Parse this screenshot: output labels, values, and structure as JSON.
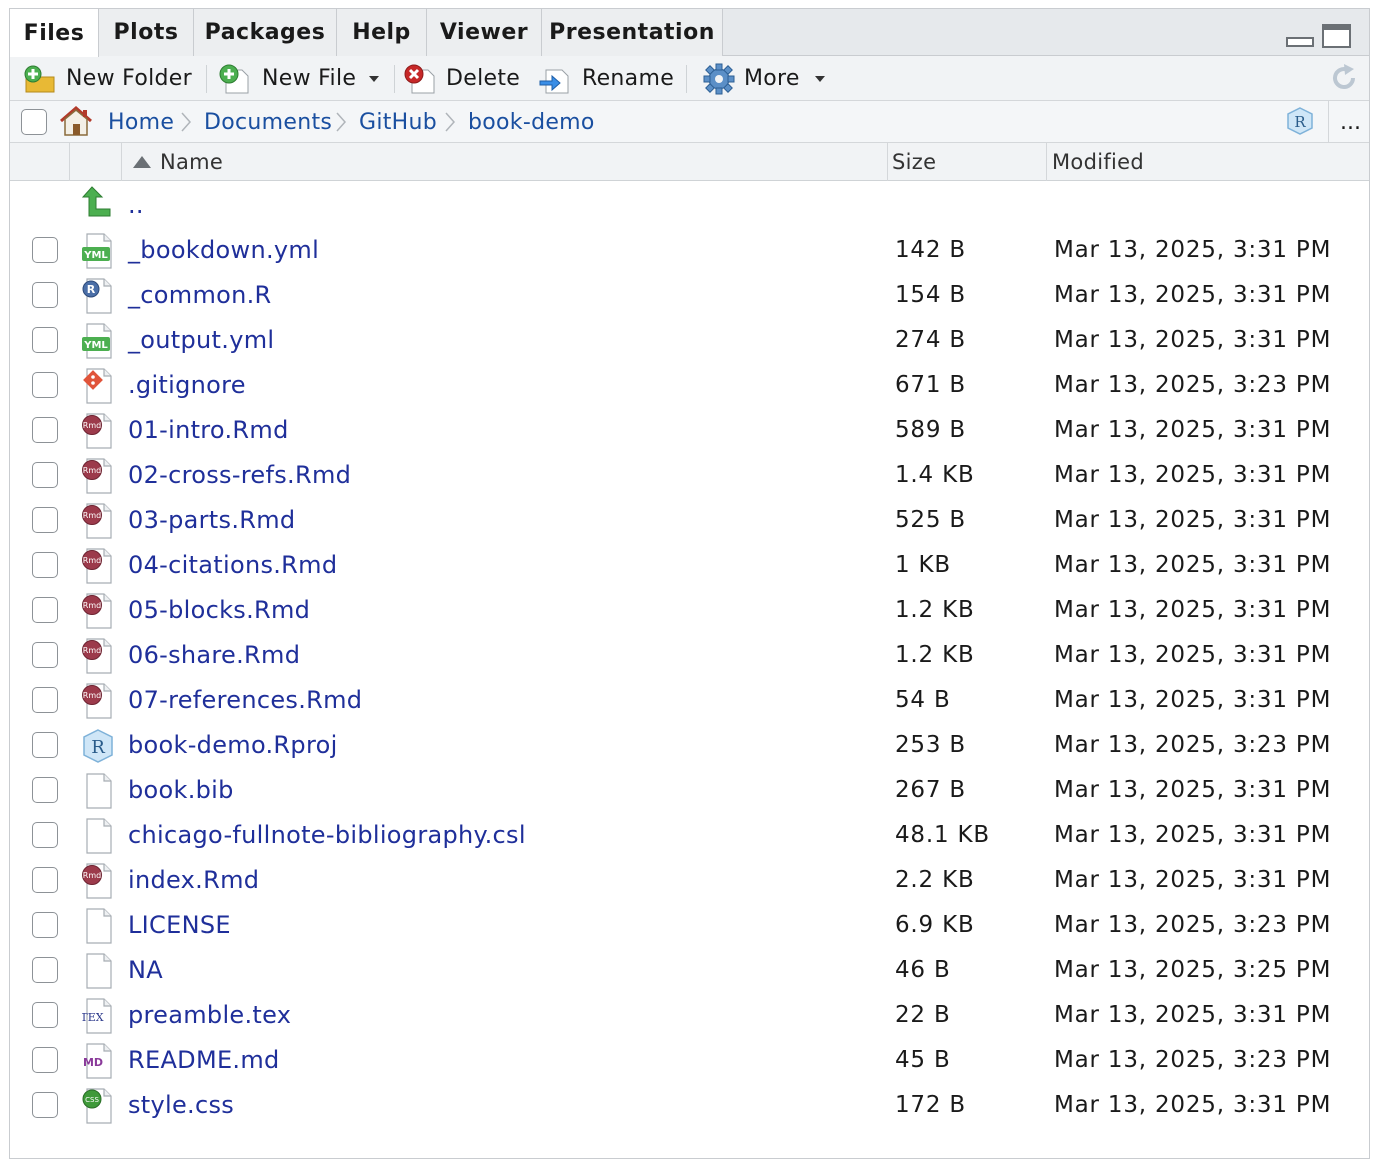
{
  "tabs": [
    "Files",
    "Plots",
    "Packages",
    "Help",
    "Viewer",
    "Presentation"
  ],
  "toolbar": {
    "new_folder": "New Folder",
    "new_file": "New File",
    "delete": "Delete",
    "rename": "Rename",
    "more": "More"
  },
  "breadcrumb": [
    "Home",
    "Documents",
    "GitHub",
    "book-demo"
  ],
  "more_label": "...",
  "columns": {
    "name": "Name",
    "size": "Size",
    "modified": "Modified"
  },
  "parent_dir": "..",
  "files": [
    {
      "name": "_bookdown.yml",
      "size": "142 B",
      "modified": "Mar 13, 2025, 3:31 PM",
      "icon": "yml"
    },
    {
      "name": "_common.R",
      "size": "154 B",
      "modified": "Mar 13, 2025, 3:31 PM",
      "icon": "r"
    },
    {
      "name": "_output.yml",
      "size": "274 B",
      "modified": "Mar 13, 2025, 3:31 PM",
      "icon": "yml"
    },
    {
      "name": ".gitignore",
      "size": "671 B",
      "modified": "Mar 13, 2025, 3:23 PM",
      "icon": "git"
    },
    {
      "name": "01-intro.Rmd",
      "size": "589 B",
      "modified": "Mar 13, 2025, 3:31 PM",
      "icon": "rmd"
    },
    {
      "name": "02-cross-refs.Rmd",
      "size": "1.4 KB",
      "modified": "Mar 13, 2025, 3:31 PM",
      "icon": "rmd"
    },
    {
      "name": "03-parts.Rmd",
      "size": "525 B",
      "modified": "Mar 13, 2025, 3:31 PM",
      "icon": "rmd"
    },
    {
      "name": "04-citations.Rmd",
      "size": "1 KB",
      "modified": "Mar 13, 2025, 3:31 PM",
      "icon": "rmd"
    },
    {
      "name": "05-blocks.Rmd",
      "size": "1.2 KB",
      "modified": "Mar 13, 2025, 3:31 PM",
      "icon": "rmd"
    },
    {
      "name": "06-share.Rmd",
      "size": "1.2 KB",
      "modified": "Mar 13, 2025, 3:31 PM",
      "icon": "rmd"
    },
    {
      "name": "07-references.Rmd",
      "size": "54 B",
      "modified": "Mar 13, 2025, 3:31 PM",
      "icon": "rmd"
    },
    {
      "name": "book-demo.Rproj",
      "size": "253 B",
      "modified": "Mar 13, 2025, 3:23 PM",
      "icon": "rproj"
    },
    {
      "name": "book.bib",
      "size": "267 B",
      "modified": "Mar 13, 2025, 3:31 PM",
      "icon": "blank"
    },
    {
      "name": "chicago-fullnote-bibliography.csl",
      "size": "48.1 KB",
      "modified": "Mar 13, 2025, 3:31 PM",
      "icon": "blank"
    },
    {
      "name": "index.Rmd",
      "size": "2.2 KB",
      "modified": "Mar 13, 2025, 3:31 PM",
      "icon": "rmd"
    },
    {
      "name": "LICENSE",
      "size": "6.9 KB",
      "modified": "Mar 13, 2025, 3:23 PM",
      "icon": "blank"
    },
    {
      "name": "NA",
      "size": "46 B",
      "modified": "Mar 13, 2025, 3:25 PM",
      "icon": "blank"
    },
    {
      "name": "preamble.tex",
      "size": "22 B",
      "modified": "Mar 13, 2025, 3:31 PM",
      "icon": "tex"
    },
    {
      "name": "README.md",
      "size": "45 B",
      "modified": "Mar 13, 2025, 3:23 PM",
      "icon": "md"
    },
    {
      "name": "style.css",
      "size": "172 B",
      "modified": "Mar 13, 2025, 3:31 PM",
      "icon": "css"
    }
  ],
  "colors": {
    "link": "#1f2f9a",
    "breadcrumb_link": "#1a4fa0",
    "rmd_badge": "#9c3a4b",
    "yml_badge": "#4caf50"
  }
}
